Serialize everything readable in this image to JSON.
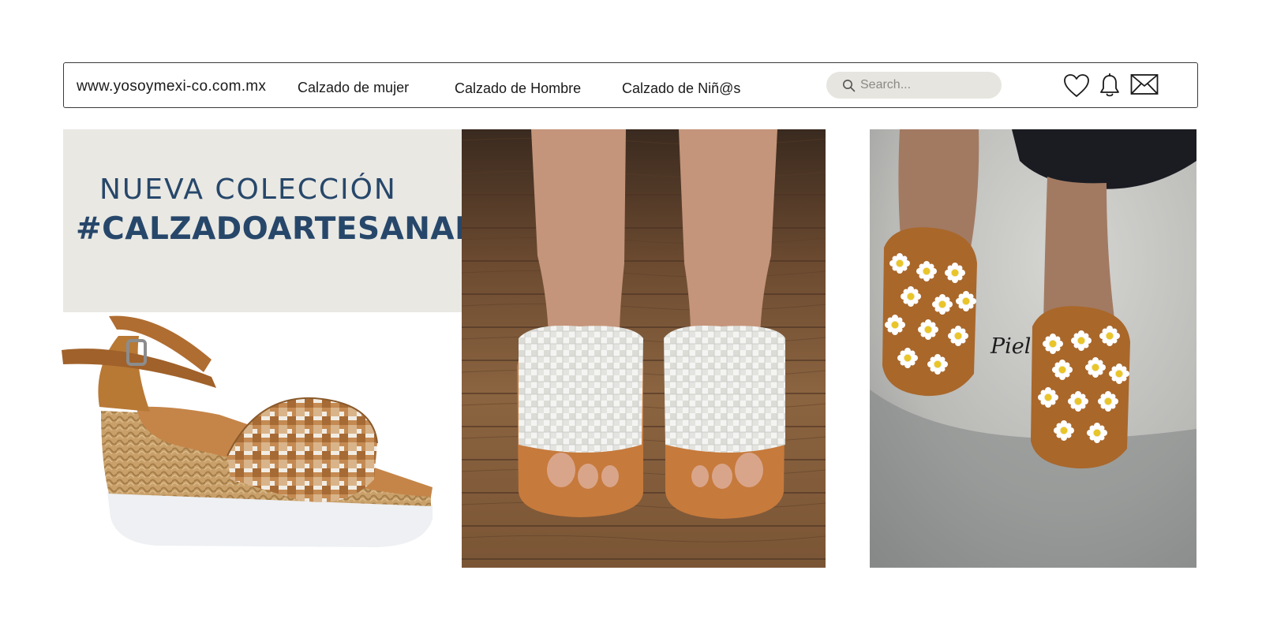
{
  "nav": {
    "brand": "www.yosoymexi-co.com.mx",
    "links": [
      {
        "label": "Calzado de mujer"
      },
      {
        "label": "Calzado de Hombre"
      },
      {
        "label": "Calzado de Niñ@s"
      }
    ],
    "search": {
      "placeholder": "Search..."
    },
    "icons": [
      "heart-icon",
      "bell-icon",
      "mail-icon"
    ]
  },
  "hero": {
    "line1": "NUEVA COLECCIÓN",
    "line2": "#CALZADOARTESANAL"
  },
  "products": {
    "caption_piel": "Piel"
  },
  "colors": {
    "brand_blue": "#27476a",
    "panel_bg": "#e9e8e3",
    "search_bg": "#e6e5df",
    "leather_tan": "#b7702c"
  }
}
